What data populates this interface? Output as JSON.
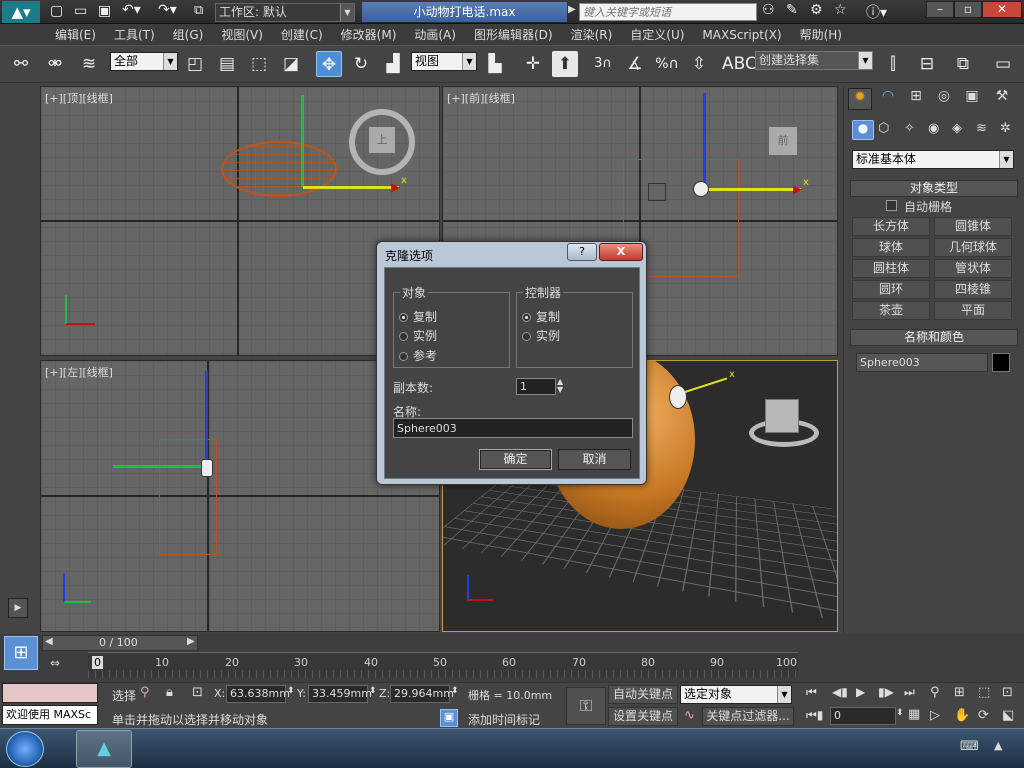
{
  "title": {
    "workspace_label": "工作区: 默认",
    "filename": "小动物打电话.max",
    "search_placeholder": "键入关键字或短语"
  },
  "menu": [
    "编辑(E)",
    "工具(T)",
    "组(G)",
    "视图(V)",
    "创建(C)",
    "修改器(M)",
    "动画(A)",
    "图形编辑器(D)",
    "渲染(R)",
    "自定义(U)",
    "MAXScript(X)",
    "帮助(H)"
  ],
  "toolbar": {
    "filter": "全部",
    "refcoord": "视图",
    "named_selection": "创建选择集",
    "snap_angle": "3",
    "percent": "%"
  },
  "viewports": {
    "top": "[+][顶][线框]",
    "front": "[+][前][线框]",
    "left": "[+][左][线框]",
    "top_label_cube": "上",
    "front_label_cube": "前"
  },
  "command_panel": {
    "category": "标准基本体",
    "object_type_header": "对象类型",
    "autogrid": "自动栅格",
    "buttons": [
      "长方体",
      "圆锥体",
      "球体",
      "几何球体",
      "圆柱体",
      "管状体",
      "圆环",
      "四棱锥",
      "茶壶",
      "平面"
    ],
    "name_color_header": "名称和颜色",
    "object_name": "Sphere003",
    "object_color": "#000000"
  },
  "dialog": {
    "title": "克隆选项",
    "object_group": "对象",
    "obj_copy": "复制",
    "obj_instance": "实例",
    "obj_reference": "参考",
    "controller_group": "控制器",
    "ctrl_copy": "复制",
    "ctrl_instance": "实例",
    "copies_label": "副本数:",
    "copies_value": "1",
    "name_label": "名称:",
    "name_value": "Sphere003",
    "ok": "确定",
    "cancel": "取消",
    "help": "?",
    "close": "X"
  },
  "timeline": {
    "frame_counter": "0 / 100",
    "ticks": [
      "10",
      "20",
      "30",
      "40",
      "50",
      "60",
      "70",
      "80",
      "90",
      "100"
    ],
    "frame_zero": "0"
  },
  "status": {
    "welcome": "欢迎使用 MAXSc",
    "select_label": "选择",
    "x_label": "X:",
    "x_value": "63.638mm",
    "y_label": "Y:",
    "y_value": "33.459mm",
    "z_label": "Z:",
    "z_value": "29.964mm",
    "grid": "栅格 = 10.0mm",
    "autokey": "自动关键点",
    "setkey": "设置关键点",
    "selected_object": "选定对象",
    "key_filter": "关键点过滤器...",
    "prompt": "单击并拖动以选择并移动对象",
    "add_time_tag": "添加时间标记",
    "frame_value": "0"
  }
}
